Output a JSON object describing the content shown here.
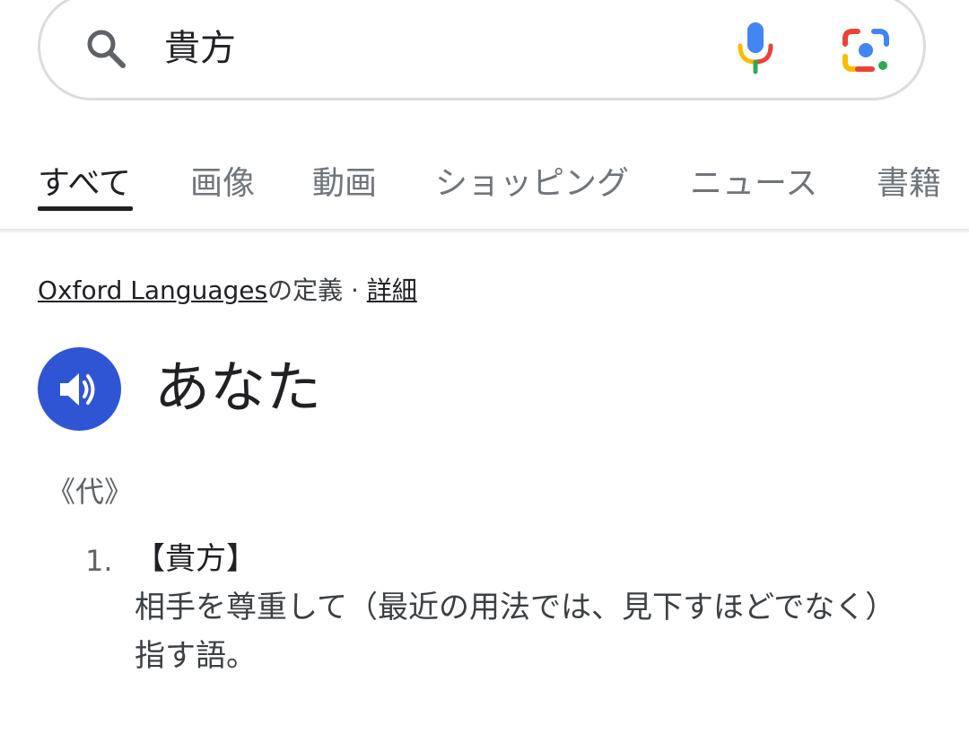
{
  "search": {
    "query": "貴方"
  },
  "tabs": [
    {
      "label": "すべて",
      "active": true
    },
    {
      "label": "画像",
      "active": false
    },
    {
      "label": "動画",
      "active": false
    },
    {
      "label": "ショッピング",
      "active": false
    },
    {
      "label": "ニュース",
      "active": false
    },
    {
      "label": "書籍",
      "active": false
    }
  ],
  "source": {
    "provider_link": "Oxford Languages",
    "suffix": "の定義",
    "separator": " · ",
    "details_link": "詳細"
  },
  "entry": {
    "headword": "あなた",
    "part_of_speech": "《代》",
    "definitions": [
      {
        "number": "1.",
        "term": "【貴方】",
        "text": "相手を尊重して（最近の用法では、見下すほどでなく）指す語。"
      }
    ]
  },
  "icons": {
    "search": "search-icon",
    "mic": "microphone-icon",
    "lens": "camera-lens-icon",
    "speaker": "speaker-icon"
  },
  "colors": {
    "accent_blue": "#2f55d4",
    "mic_blue": "#4285f4",
    "mic_red": "#ea4335",
    "mic_yellow": "#fbbc04",
    "mic_green": "#34a853"
  }
}
